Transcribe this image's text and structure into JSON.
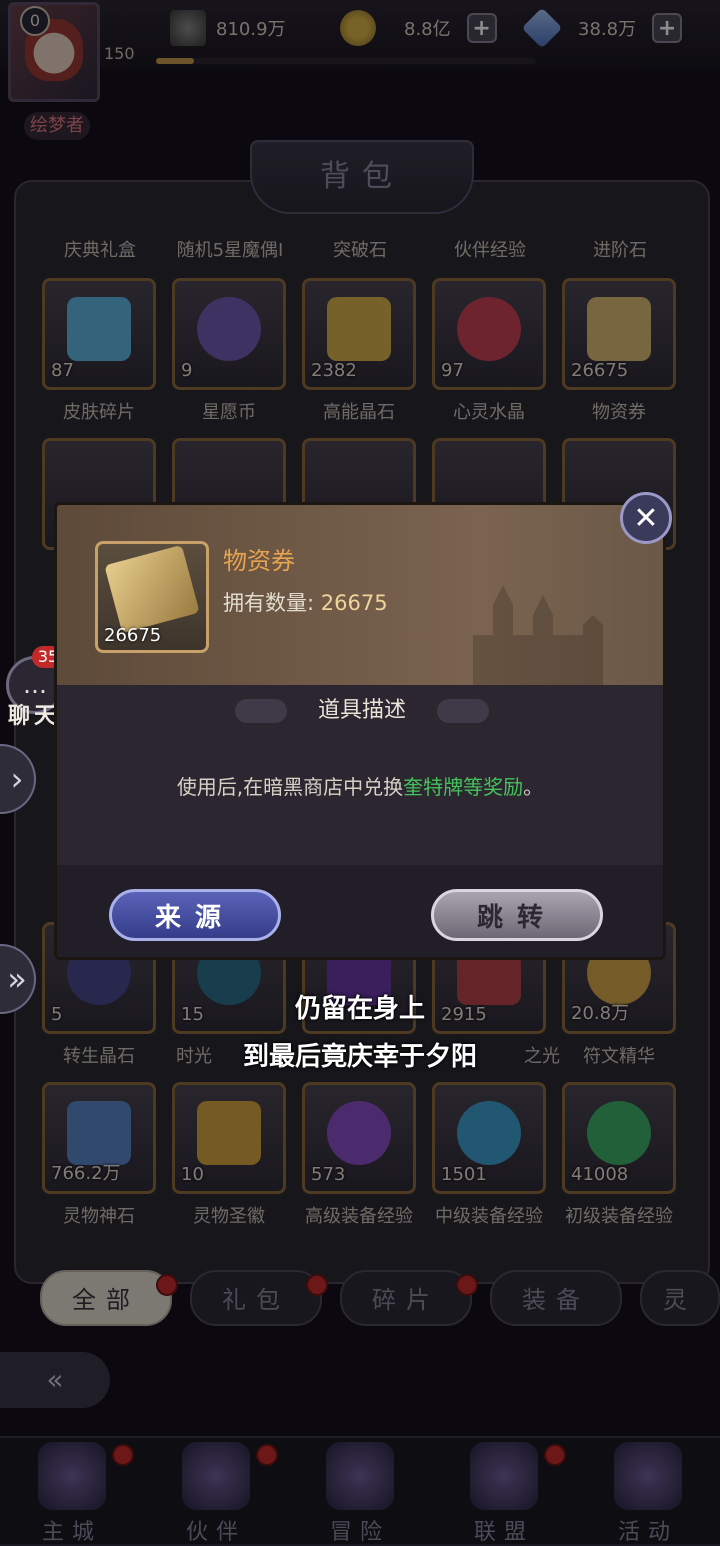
{
  "profile": {
    "level": "0",
    "exp": "150",
    "name": "绘梦者"
  },
  "resources": [
    {
      "name": "power",
      "value": "810.9万",
      "color": "#8a8a8a",
      "icon": "winged-sword-icon"
    },
    {
      "name": "gold",
      "value": "8.8亿",
      "color": "#c8a43e",
      "icon": "coin-icon"
    },
    {
      "name": "diamond",
      "value": "38.8万",
      "color": "#7aa0e6",
      "icon": "diamond-icon"
    }
  ],
  "panel_title": "背包",
  "row0_labels": [
    "庆典礼盒",
    "随机5星魔偶I",
    "突破石",
    "伙伴经验",
    "进阶石"
  ],
  "row1": [
    {
      "label": "皮肤碎片",
      "count": "87",
      "color": "#5fb6e0"
    },
    {
      "label": "星愿币",
      "count": "9",
      "color": "#6f5bb2"
    },
    {
      "label": "高能晶石",
      "count": "2382",
      "color": "#d8b34a"
    },
    {
      "label": "心灵水晶",
      "count": "97",
      "color": "#c64257"
    },
    {
      "label": "物资券",
      "count": "26675",
      "color": "#d9bb74"
    }
  ],
  "row_partial_labels": [
    "转生晶石",
    "时光",
    "",
    "之光",
    "符文精华"
  ],
  "row_partial_counts": [
    "5",
    "15",
    "",
    "2915",
    "20.8万"
  ],
  "row4": [
    {
      "label": "灵物神石",
      "count": "766.2万",
      "color": "#5c86c8"
    },
    {
      "label": "灵物圣徽",
      "count": "10",
      "color": "#d6a640"
    },
    {
      "label": "高级装备经验",
      "count": "573",
      "color": "#8a4ec8"
    },
    {
      "label": "中级装备经验",
      "count": "1501",
      "color": "#3f9ed0"
    },
    {
      "label": "初级装备经验",
      "count": "41008",
      "color": "#3fb06a"
    }
  ],
  "tabs": [
    "全部",
    "礼包",
    "碎片",
    "装备",
    "灵"
  ],
  "nav": [
    "主城",
    "伙伴",
    "冒险",
    "联盟",
    "活动"
  ],
  "chat": {
    "badge": "35",
    "label": "聊天"
  },
  "modal": {
    "item_name": "物资券",
    "owned_label": "拥有数量:",
    "owned_value": "26675",
    "icon_count": "26675",
    "desc_title": "道具描述",
    "desc_prefix": "使用后,在暗黑商店中兑换",
    "desc_highlight": "奎特牌等奖励",
    "desc_suffix": "。",
    "btn_source": "来源",
    "btn_jump": "跳转",
    "close": "✕"
  },
  "subtitles": [
    "仍留在身上",
    "到最后竟庆幸于夕阳"
  ]
}
